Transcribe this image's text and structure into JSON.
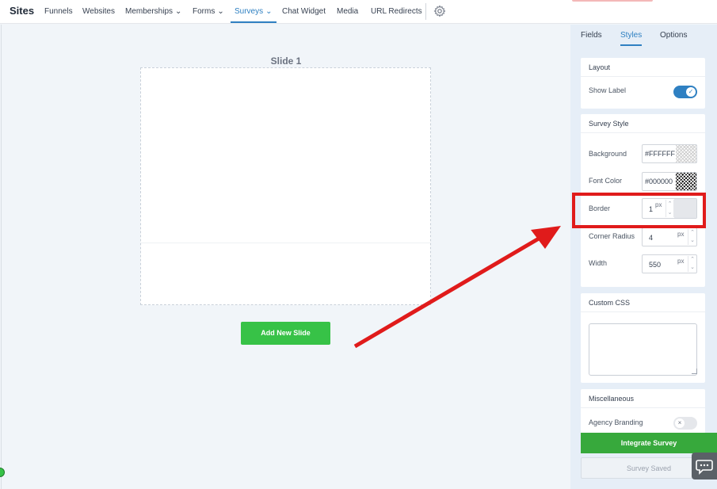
{
  "nav": {
    "brand": "Sites",
    "items": [
      {
        "label": "Funnels",
        "chevron": ""
      },
      {
        "label": "Websites",
        "chevron": ""
      },
      {
        "label": "Memberships",
        "chevron": "⌄"
      },
      {
        "label": "Forms",
        "chevron": "⌄"
      },
      {
        "label": "Surveys",
        "chevron": "⌄"
      },
      {
        "label": "Chat Widget",
        "chevron": ""
      },
      {
        "label": "Media",
        "chevron": ""
      },
      {
        "label": "URL Redirects",
        "chevron": ""
      }
    ],
    "active_item": "Surveys",
    "settings_icon": "gear-icon"
  },
  "canvas": {
    "slide_title": "Slide 1",
    "add_slide_label": "Add New Slide"
  },
  "panel": {
    "tabs": [
      {
        "label": "Fields"
      },
      {
        "label": "Styles"
      },
      {
        "label": "Options"
      }
    ],
    "active_tab": "Styles",
    "layout": {
      "heading": "Layout",
      "show_label": "Show Label",
      "show_label_on": true,
      "toggle_on_icon": "✓"
    },
    "survey_style": {
      "heading": "Survey Style",
      "background_label": "Background",
      "background_value": "#FFFFFF",
      "font_color_label": "Font Color",
      "font_color_value": "#000000",
      "border_label": "Border",
      "border_value": "1",
      "border_unit": "px",
      "corner_radius_label": "Corner Radius",
      "corner_radius_value": "4",
      "corner_radius_unit": "px",
      "width_label": "Width",
      "width_value": "550",
      "width_unit": "px",
      "spin_up": "⌃",
      "spin_down": "⌄"
    },
    "custom_css": {
      "heading": "Custom CSS",
      "value": ""
    },
    "misc": {
      "heading": "Miscellaneous",
      "agency_branding": "Agency Branding",
      "agency_branding_on": false,
      "toggle_off_icon": "×"
    },
    "integrate_label": "Integrate Survey",
    "saved_label": "Survey Saved"
  },
  "colors": {
    "accent": "#2f80c2",
    "green": "#37c247",
    "highlight": "#e01b1b"
  }
}
